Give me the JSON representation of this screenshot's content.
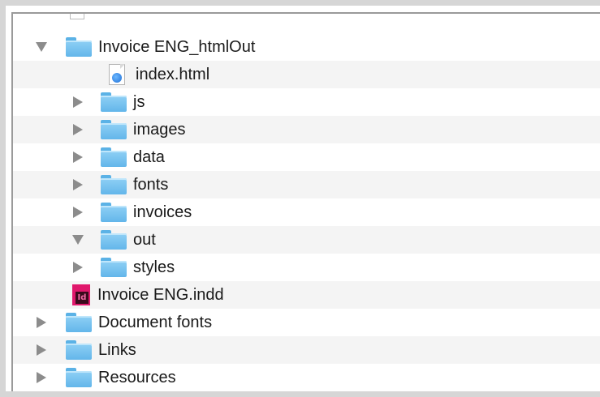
{
  "window": {
    "title": ""
  },
  "tree": {
    "rows": [
      {
        "label": "Invoice ENG_htmlOut",
        "indent": 0,
        "expanded": true,
        "kind": "folder"
      },
      {
        "label": "index.html",
        "indent": 1,
        "expanded": null,
        "kind": "html-file"
      },
      {
        "label": "js",
        "indent": 1,
        "expanded": false,
        "kind": "folder"
      },
      {
        "label": "images",
        "indent": 1,
        "expanded": false,
        "kind": "folder"
      },
      {
        "label": "data",
        "indent": 1,
        "expanded": false,
        "kind": "folder"
      },
      {
        "label": "fonts",
        "indent": 1,
        "expanded": false,
        "kind": "folder"
      },
      {
        "label": "invoices",
        "indent": 1,
        "expanded": false,
        "kind": "folder"
      },
      {
        "label": "out",
        "indent": 1,
        "expanded": true,
        "kind": "folder"
      },
      {
        "label": "styles",
        "indent": 1,
        "expanded": false,
        "kind": "folder"
      },
      {
        "label": "Invoice ENG.indd",
        "indent": 0,
        "expanded": null,
        "kind": "indd-file"
      },
      {
        "label": "Document fonts",
        "indent": 0,
        "expanded": false,
        "kind": "folder"
      },
      {
        "label": "Links",
        "indent": 0,
        "expanded": false,
        "kind": "folder"
      },
      {
        "label": "Resources",
        "indent": 0,
        "expanded": false,
        "kind": "folder"
      }
    ]
  },
  "icons": {
    "disclosure_collapsed": "triangle-right",
    "disclosure_expanded": "triangle-down",
    "folder": "folder-icon",
    "html_file": "html-file-icon",
    "indd_file": "indesign-file-icon",
    "indd_glyph": "Id"
  },
  "colors": {
    "folder": "#63b6ea",
    "row_alt": "#f4f4f4",
    "indd": "#e0186c"
  }
}
